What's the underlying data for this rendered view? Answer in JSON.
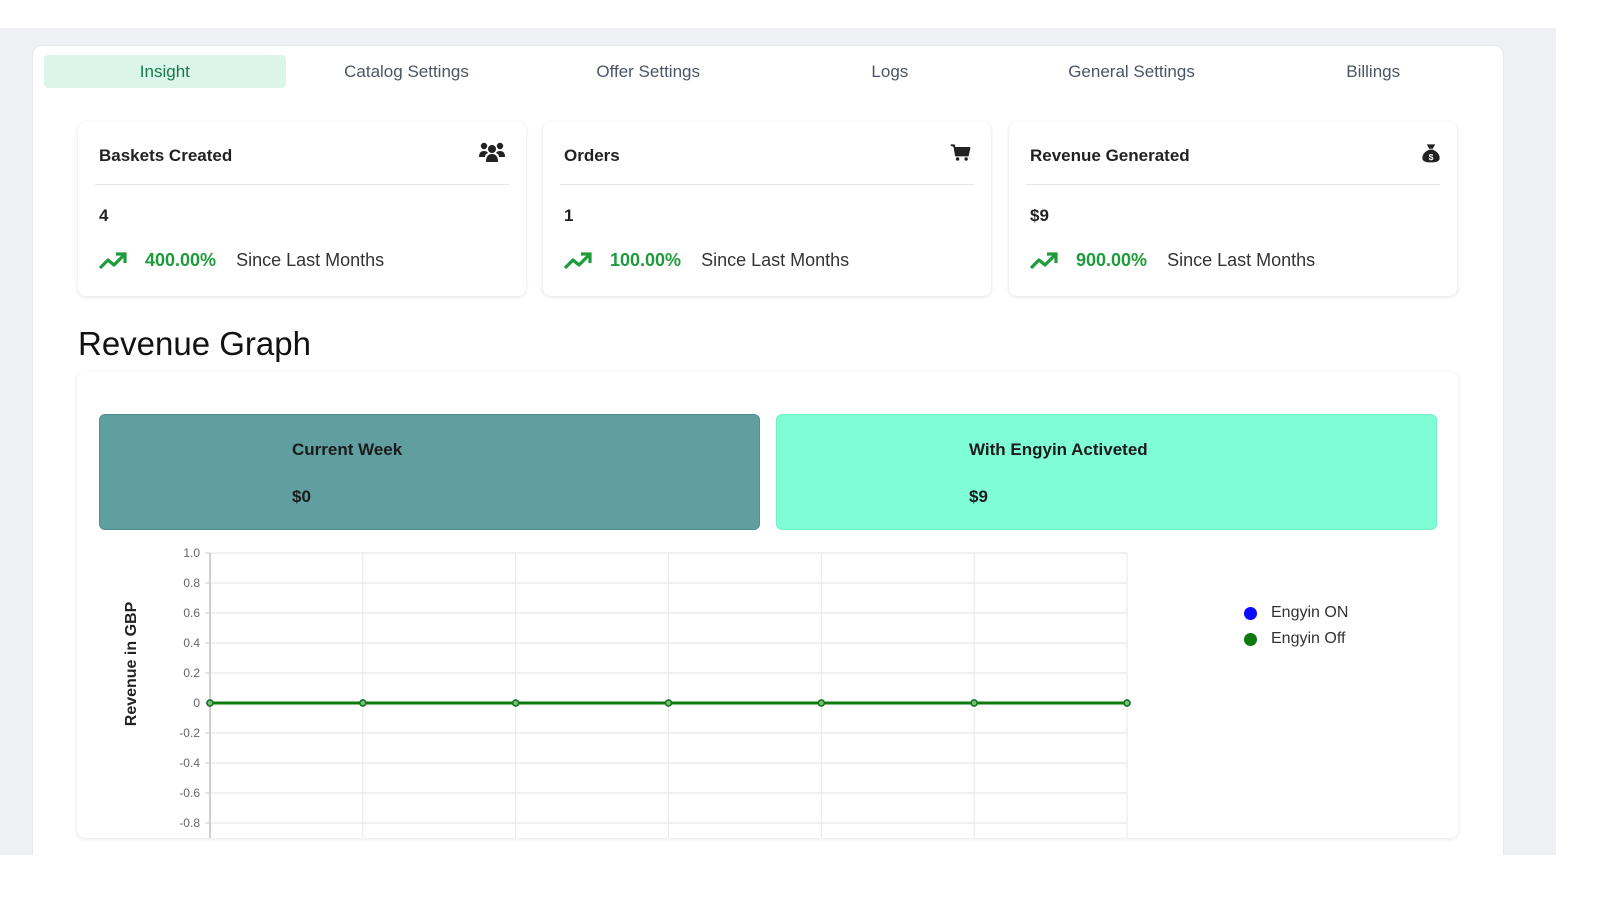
{
  "tabs": [
    {
      "label": "Insight",
      "active": true
    },
    {
      "label": "Catalog Settings",
      "active": false
    },
    {
      "label": "Offer Settings",
      "active": false
    },
    {
      "label": "Logs",
      "active": false
    },
    {
      "label": "General Settings",
      "active": false
    },
    {
      "label": "Billings",
      "active": false
    }
  ],
  "stats": [
    {
      "title": "Baskets Created",
      "icon": "users-icon",
      "value": "4",
      "trend_icon": "trending-up-icon",
      "percent": "400.00%",
      "trend_label": "Since Last Months"
    },
    {
      "title": "Orders",
      "icon": "shopping-cart-icon",
      "value": "1",
      "trend_icon": "trending-up-icon",
      "percent": "100.00%",
      "trend_label": "Since Last Months"
    },
    {
      "title": "Revenue Generated",
      "icon": "money-bag-icon",
      "value": "$9",
      "trend_icon": "trending-up-icon",
      "percent": "900.00%",
      "trend_label": "Since Last Months"
    }
  ],
  "revenue_graph": {
    "title": "Revenue Graph",
    "summary": [
      {
        "label": "Current Week",
        "value": "$0"
      },
      {
        "label": "With Engyin Activeted",
        "value": "$9"
      }
    ]
  },
  "colors": {
    "accent_green": "#1e9b3a",
    "tab_active_bg": "#dcf5ea",
    "current_week_bg": "#619e9f",
    "engyin_bg": "#7ffdd4",
    "series_on": "#0a0aff",
    "series_off": "#0d7a0d"
  },
  "chart_data": {
    "type": "line",
    "title": "",
    "xlabel": "",
    "ylabel": "Revenue in GBP",
    "x": [
      0,
      1,
      2,
      3,
      4,
      5,
      6
    ],
    "x_tick_labels": [],
    "ylim": [
      -0.9,
      1.0
    ],
    "y_ticks": [
      1.0,
      0.8,
      0.6,
      0.4,
      0.2,
      0,
      -0.2,
      -0.4,
      -0.6,
      -0.8
    ],
    "y_tick_labels": [
      "1.0",
      "0.8",
      "0.6",
      "0.4",
      "0.2",
      "0",
      "-0.2",
      "-0.4",
      "-0.6",
      "-0.8"
    ],
    "grid": true,
    "legend_position": "right",
    "series": [
      {
        "name": "Engyin ON",
        "color": "#0a0aff",
        "values": [
          0,
          0,
          0,
          0,
          0,
          0,
          0
        ]
      },
      {
        "name": "Engyin Off",
        "color": "#0d7a0d",
        "values": [
          0,
          0,
          0,
          0,
          0,
          0,
          0
        ]
      }
    ]
  }
}
